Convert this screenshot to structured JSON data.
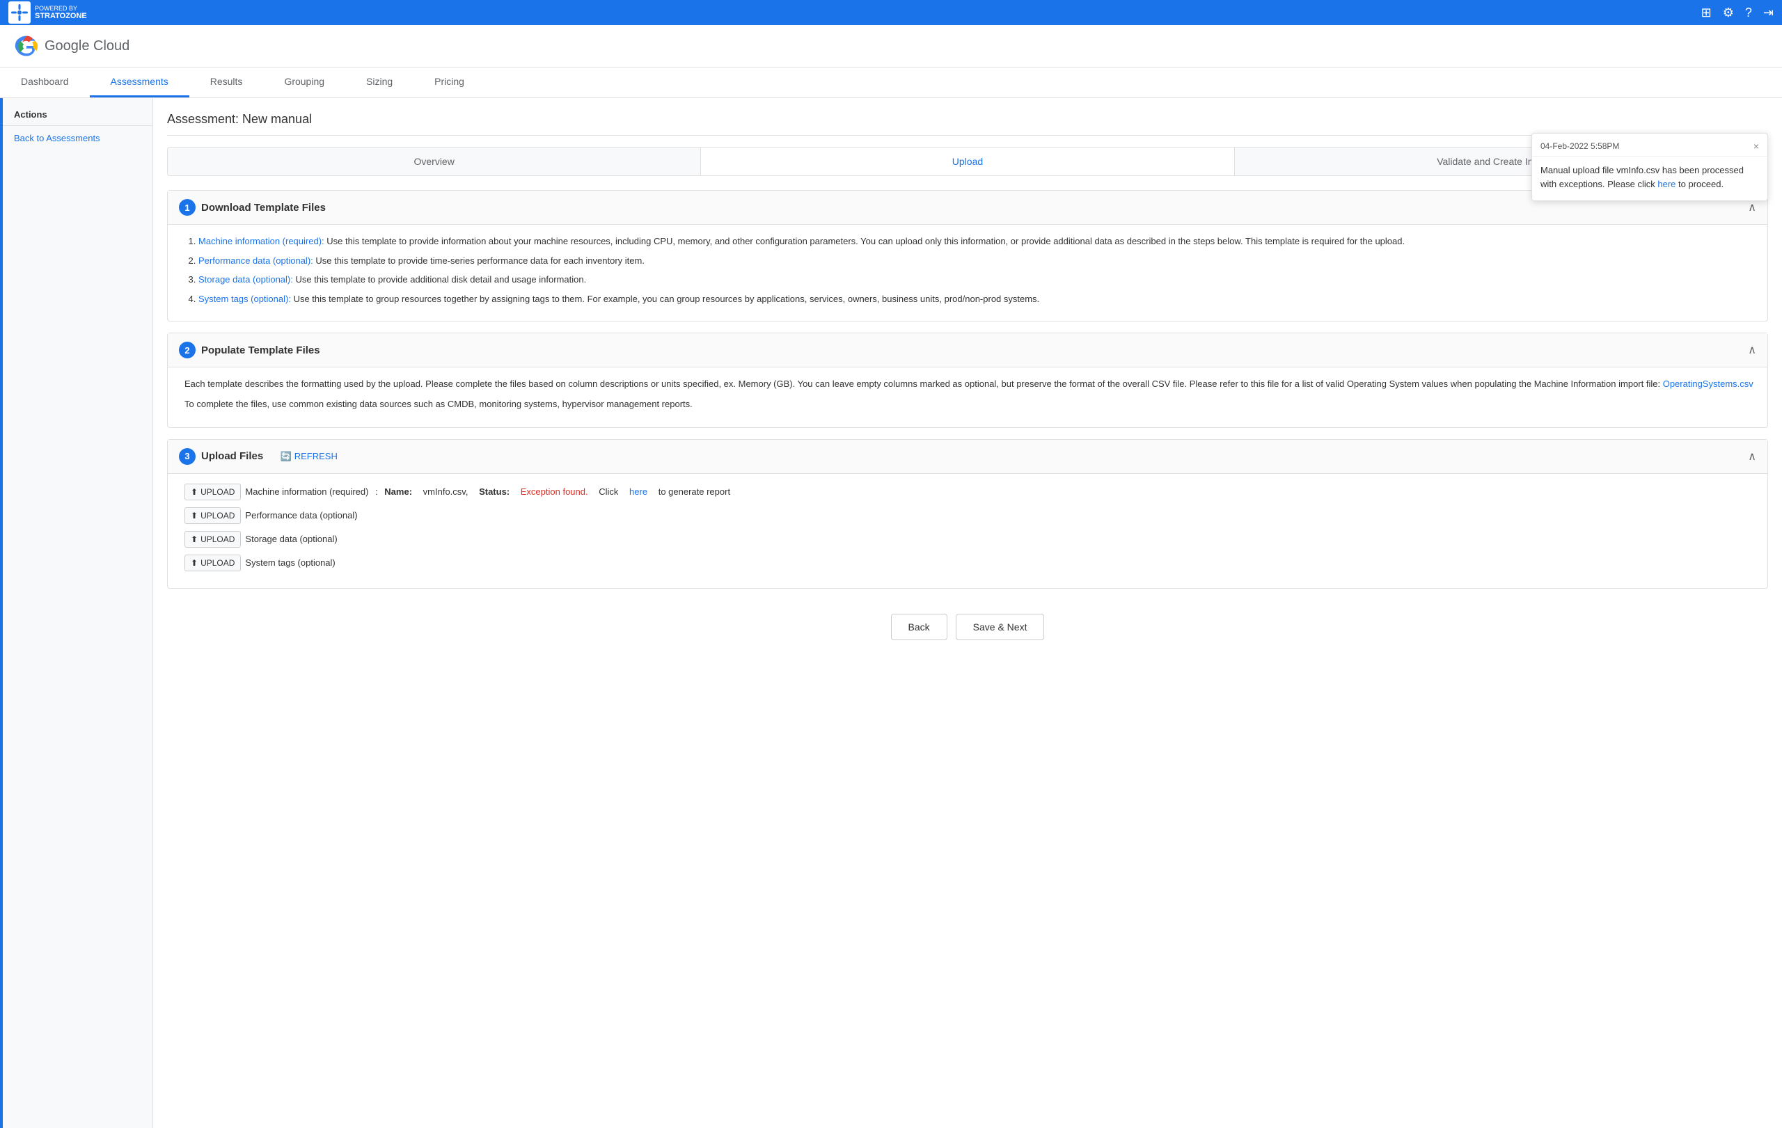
{
  "topbar": {
    "logo_line1": "POWERED BY",
    "logo_line2": "STRATOZONE",
    "icons": [
      "grid-icon",
      "settings-icon",
      "help-icon",
      "logout-icon"
    ]
  },
  "header": {
    "google_cloud_text": "Google Cloud"
  },
  "nav": {
    "tabs": [
      {
        "label": "Dashboard",
        "active": false
      },
      {
        "label": "Assessments",
        "active": true
      },
      {
        "label": "Results",
        "active": false
      },
      {
        "label": "Grouping",
        "active": false
      },
      {
        "label": "Sizing",
        "active": false
      },
      {
        "label": "Pricing",
        "active": false
      }
    ]
  },
  "sidebar": {
    "section_title": "Actions",
    "items": [
      {
        "label": "Back to Assessments"
      }
    ]
  },
  "assessment": {
    "title": "Assessment: New manual"
  },
  "subtabs": [
    {
      "label": "Overview",
      "active": false
    },
    {
      "label": "Upload",
      "active": true
    },
    {
      "label": "Validate and Create Inventory",
      "active": false
    }
  ],
  "sections": {
    "download": {
      "number": "1",
      "title": "Download Template Files",
      "items": [
        {
          "link": "Machine information (required):",
          "text": " Use this template to provide information about your machine resources, including CPU, memory, and other configuration parameters. You can upload only this information, or provide additional data as described in the steps below. This template is required for the upload."
        },
        {
          "link": "Performance data (optional):",
          "text": " Use this template to provide time-series performance data for each inventory item."
        },
        {
          "link": "Storage data (optional):",
          "text": " Use this template to provide additional disk detail and usage information."
        },
        {
          "link": "System tags (optional):",
          "text": " Use this template to group resources together by assigning tags to them. For example, you can group resources by applications, services, owners, business units, prod/non-prod systems."
        }
      ]
    },
    "populate": {
      "number": "2",
      "title": "Populate Template Files",
      "para1": "Each template describes the formatting used by the upload. Please complete the files based on column descriptions or units specified, ex. Memory (GB). You can leave empty columns marked as optional, but preserve the format of the overall CSV file. Please refer to this file for a list of valid Operating System values when populating the Machine Information import file:",
      "link": "OperatingSystems.csv",
      "para2": "To complete the files, use common existing data sources such as CMDB, monitoring systems, hypervisor management reports."
    },
    "upload": {
      "number": "3",
      "title": "Upload Files",
      "refresh_label": "REFRESH",
      "rows": [
        {
          "btn": "UPLOAD",
          "label": "Machine information (required)",
          "has_status": true,
          "name_label": "Name:",
          "name_value": "vmInfo.csv,",
          "status_label": "Status:",
          "status_value": "Exception found.",
          "click_text": "Click",
          "here_link": "here",
          "after_link": "to generate report"
        },
        {
          "btn": "UPLOAD",
          "label": "Performance data (optional)",
          "has_status": false
        },
        {
          "btn": "UPLOAD",
          "label": "Storage data (optional)",
          "has_status": false
        },
        {
          "btn": "UPLOAD",
          "label": "System tags (optional)",
          "has_status": false
        }
      ]
    }
  },
  "buttons": {
    "back": "Back",
    "save_next": "Save & Next"
  },
  "notification": {
    "timestamp": "04-Feb-2022 5:58PM",
    "message": "Manual upload file vmInfo.csv has been processed with exceptions. Please click",
    "link": "here",
    "message_end": "to proceed.",
    "close_icon": "×"
  }
}
